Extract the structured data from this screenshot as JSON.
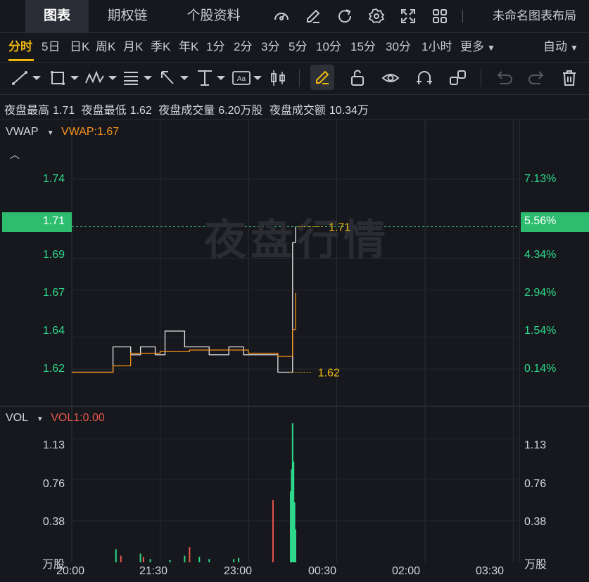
{
  "tabs": [
    {
      "label": "图表",
      "active": true
    },
    {
      "label": "期权链",
      "active": false
    },
    {
      "label": "个股资料",
      "active": false
    }
  ],
  "top_icons": [
    "gauge-icon",
    "edit-icon",
    "refresh-icon",
    "settings-icon",
    "fullscreen-icon",
    "grid-layout-icon"
  ],
  "layout_name": "未命名图表布局",
  "periods": [
    "分时",
    "5日",
    "日K",
    "周K",
    "月K",
    "季K",
    "年K",
    "1分",
    "2分",
    "3分",
    "5分",
    "10分",
    "15分",
    "30分",
    "1小时",
    "更多"
  ],
  "active_period": "分时",
  "auto_label": "自动",
  "info": {
    "high_label": "夜盘最高",
    "high_value": "1.71",
    "low_label": "夜盘最低",
    "low_value": "1.62",
    "vol_label": "夜盘成交量",
    "vol_value": "6.20万股",
    "amt_label": "夜盘成交额",
    "amt_value": "10.34万"
  },
  "main_panel": {
    "indicator": "VWAP",
    "indicator_value": "VWAP:1.67",
    "watermark": "夜盘行情",
    "current_price": "1.71",
    "current_pct": "5.56%",
    "high_marker": "1.71",
    "low_marker": "1.62",
    "price_labels": [
      "1.74",
      "1.71",
      "1.69",
      "1.67",
      "1.64",
      "1.62"
    ],
    "pct_labels": [
      "7.13%",
      "5.56%",
      "4.34%",
      "2.94%",
      "1.54%",
      "0.14%"
    ]
  },
  "vol_panel": {
    "indicator": "VOL",
    "indicator_value": "VOL1:0.00",
    "left_labels": [
      "1.13",
      "0.76",
      "0.38",
      "万股"
    ],
    "right_labels": [
      "1.13",
      "0.76",
      "0.38",
      "万股"
    ]
  },
  "x_labels": [
    "20:00",
    "21:30",
    "23:00",
    "00:30",
    "02:00",
    "03:30"
  ],
  "colors": {
    "up": "#2ed88a",
    "down": "#e8574a",
    "vwap": "#f7931a",
    "price": "#e6e6e6",
    "accent": "#f0b90b"
  },
  "chart_data": {
    "type": "line",
    "series": [
      {
        "name": "price",
        "x": [
          "20:00",
          "20:40",
          "20:42",
          "21:00",
          "21:10",
          "21:25",
          "21:35",
          "21:45",
          "21:55",
          "22:10",
          "22:20",
          "22:40",
          "22:55",
          "23:00",
          "23:30",
          "23:42",
          "23:45",
          "23:48"
        ],
        "values": [
          1.618,
          1.618,
          1.634,
          1.629,
          1.634,
          1.629,
          1.644,
          1.644,
          1.634,
          1.634,
          1.629,
          1.634,
          1.629,
          1.629,
          1.618,
          1.618,
          1.7,
          1.71
        ]
      },
      {
        "name": "VWAP",
        "x": [
          "20:00",
          "20:30",
          "20:42",
          "21:00",
          "21:30",
          "22:00",
          "22:30",
          "23:00",
          "23:30",
          "23:42",
          "23:45",
          "23:48"
        ],
        "values": [
          1.618,
          1.618,
          1.622,
          1.63,
          1.631,
          1.632,
          1.632,
          1.63,
          1.628,
          1.628,
          1.645,
          1.668
        ]
      }
    ],
    "volume": [
      {
        "t": "20:45",
        "v": 0.12,
        "dir": "up"
      },
      {
        "t": "20:50",
        "v": 0.06,
        "dir": "down"
      },
      {
        "t": "21:10",
        "v": 0.08,
        "dir": "up"
      },
      {
        "t": "21:13",
        "v": 0.05,
        "dir": "down"
      },
      {
        "t": "21:20",
        "v": 0.03,
        "dir": "up"
      },
      {
        "t": "21:40",
        "v": 0.02,
        "dir": "up"
      },
      {
        "t": "21:55",
        "v": 0.06,
        "dir": "up"
      },
      {
        "t": "22:00",
        "v": 0.14,
        "dir": "down"
      },
      {
        "t": "22:10",
        "v": 0.05,
        "dir": "up"
      },
      {
        "t": "22:20",
        "v": 0.03,
        "dir": "up"
      },
      {
        "t": "22:45",
        "v": 0.03,
        "dir": "up"
      },
      {
        "t": "22:50",
        "v": 0.04,
        "dir": "up"
      },
      {
        "t": "23:25",
        "v": 0.57,
        "dir": "down"
      },
      {
        "t": "23:43",
        "v": 0.65,
        "dir": "up"
      },
      {
        "t": "23:44",
        "v": 0.85,
        "dir": "up"
      },
      {
        "t": "23:45",
        "v": 1.27,
        "dir": "up"
      },
      {
        "t": "23:46",
        "v": 0.92,
        "dir": "up"
      },
      {
        "t": "23:47",
        "v": 0.55,
        "dir": "up"
      },
      {
        "t": "23:48",
        "v": 0.3,
        "dir": "up"
      }
    ],
    "ylim": [
      1.6,
      1.76
    ],
    "volume_ylim": [
      0,
      1.4
    ]
  }
}
